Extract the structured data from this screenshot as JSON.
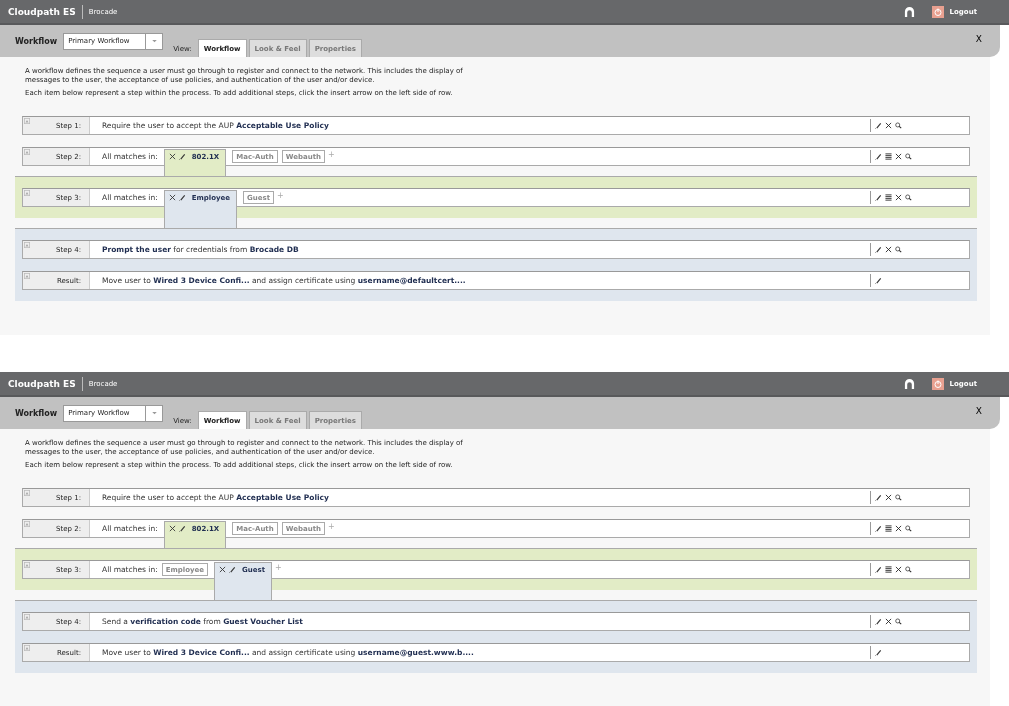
{
  "panels": [
    {
      "header": {
        "product": "Cloudpath ES",
        "org": "Brocade",
        "logout": "Logout"
      },
      "toolbar": {
        "label": "Workflow",
        "workflow": "Primary Workflow",
        "view_label": "View:",
        "tabs": [
          {
            "label": "Workflow",
            "selected": true
          },
          {
            "label": "Look & Feel",
            "selected": false
          },
          {
            "label": "Properties",
            "selected": false
          }
        ],
        "close": "X"
      },
      "intro": [
        "A workflow defines the sequence a user must go through to register and connect to the network. This includes the display of messages to the user, the acceptance of use policies, and authentication of the user and/or device.",
        "Each item below represent a step within the process. To add additional steps, click the insert arrow on the left side of row."
      ],
      "groups": [
        {
          "kind": "plain",
          "steps": [
            {
              "label": "Step 1:",
              "kind": "text",
              "text": "Require the user to accept the AUP **Acceptable Use Policy**",
              "actions": [
                {
                  "kind": "edit"
                },
                {
                  "kind": "delete"
                },
                {
                  "kind": "search"
                }
              ]
            },
            {
              "label": "Step 2:",
              "kind": "matches",
              "text": "All matches in:",
              "options": [
                {
                  "label": "802.1X",
                  "selected": true
                },
                {
                  "label": "Mac-Auth",
                  "selected": false
                },
                {
                  "label": "Webauth",
                  "selected": false
                }
              ],
              "add": "+",
              "actions": [
                {
                  "kind": "edit"
                },
                {
                  "kind": "reorder"
                },
                {
                  "kind": "delete"
                },
                {
                  "kind": "search"
                }
              ]
            }
          ]
        },
        {
          "kind": "green",
          "steps": [
            {
              "label": "Step 3:",
              "kind": "matches",
              "text": "All matches in:",
              "options": [
                {
                  "label": "Employee",
                  "selected": true
                },
                {
                  "label": "Guest",
                  "selected": false
                }
              ],
              "add": "+",
              "actions": [
                {
                  "kind": "edit"
                },
                {
                  "kind": "reorder"
                },
                {
                  "kind": "delete"
                },
                {
                  "kind": "search"
                }
              ]
            }
          ]
        },
        {
          "kind": "blue",
          "steps": [
            {
              "label": "Step 4:",
              "kind": "text",
              "text": "**Prompt the user** for credentials from **Brocade DB**",
              "actions": [
                {
                  "kind": "edit"
                },
                {
                  "kind": "delete"
                },
                {
                  "kind": "search"
                }
              ]
            },
            {
              "label": "Result:",
              "kind": "text",
              "text": "Move user to **Wired 3 Device Confi...** and assign certificate using **username@defaultcert....**",
              "actions": [
                {
                  "kind": "edit"
                }
              ]
            }
          ]
        }
      ]
    },
    {
      "header": {
        "product": "Cloudpath ES",
        "org": "Brocade",
        "logout": "Logout"
      },
      "toolbar": {
        "label": "Workflow",
        "workflow": "Primary Workflow",
        "view_label": "View:",
        "tabs": [
          {
            "label": "Workflow",
            "selected": true
          },
          {
            "label": "Look & Feel",
            "selected": false
          },
          {
            "label": "Properties",
            "selected": false
          }
        ],
        "close": "X"
      },
      "intro": [
        "A workflow defines the sequence a user must go through to register and connect to the network. This includes the display of messages to the user, the acceptance of use policies, and authentication of the user and/or device.",
        "Each item below represent a step within the process. To add additional steps, click the insert arrow on the left side of row."
      ],
      "groups": [
        {
          "kind": "plain",
          "steps": [
            {
              "label": "Step 1:",
              "kind": "text",
              "text": "Require the user to accept the AUP **Acceptable Use Policy**",
              "actions": [
                {
                  "kind": "edit"
                },
                {
                  "kind": "delete"
                },
                {
                  "kind": "search"
                }
              ]
            },
            {
              "label": "Step 2:",
              "kind": "matches",
              "text": "All matches in:",
              "options": [
                {
                  "label": "802.1X",
                  "selected": true
                },
                {
                  "label": "Mac-Auth",
                  "selected": false
                },
                {
                  "label": "Webauth",
                  "selected": false
                }
              ],
              "add": "+",
              "actions": [
                {
                  "kind": "edit"
                },
                {
                  "kind": "reorder"
                },
                {
                  "kind": "delete"
                },
                {
                  "kind": "search"
                }
              ]
            }
          ]
        },
        {
          "kind": "green",
          "steps": [
            {
              "label": "Step 3:",
              "kind": "matches",
              "text": "All matches in:",
              "options": [
                {
                  "label": "Employee",
                  "selected": false
                },
                {
                  "label": "Guest",
                  "selected": true
                }
              ],
              "add": "+",
              "actions": [
                {
                  "kind": "edit"
                },
                {
                  "kind": "reorder"
                },
                {
                  "kind": "delete"
                },
                {
                  "kind": "search"
                }
              ]
            }
          ]
        },
        {
          "kind": "blue",
          "steps": [
            {
              "label": "Step 4:",
              "kind": "text",
              "text": "Send a **verification code** from **Guest Voucher List**",
              "actions": [
                {
                  "kind": "edit"
                },
                {
                  "kind": "delete"
                },
                {
                  "kind": "search"
                }
              ]
            },
            {
              "label": "Result:",
              "kind": "text",
              "text": "Move user to **Wired 3 Device Confi...** and assign certificate using **username@guest.www.b....**",
              "actions": [
                {
                  "kind": "edit"
                }
              ]
            }
          ]
        }
      ]
    }
  ]
}
